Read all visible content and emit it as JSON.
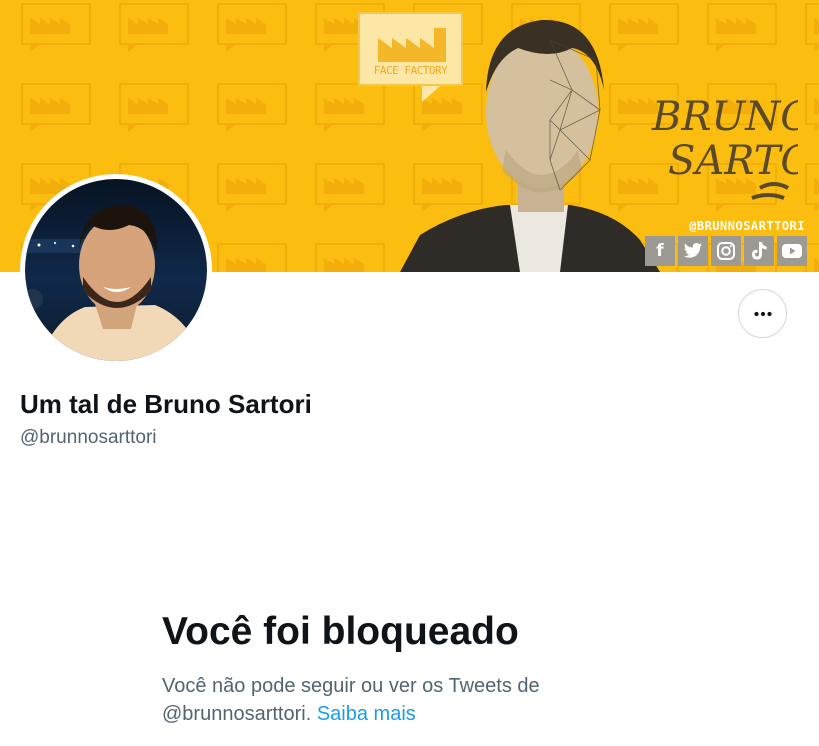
{
  "colors": {
    "banner_bg": "#fbbd0f",
    "primary_text": "#0f1419",
    "secondary_text": "#536471",
    "link": "#1d9bf0",
    "border": "#cfd9de"
  },
  "banner": {
    "brand_logo_text": "FACE FACTORY",
    "signature_text": "BRUNO SARTORI",
    "handle_text": "@BRUNNOSARTTORI",
    "social_icons": [
      "facebook-icon",
      "twitter-icon",
      "instagram-icon",
      "tiktok-icon",
      "youtube-icon"
    ]
  },
  "profile": {
    "display_name": "Um tal de Bruno Sartori",
    "handle": "@brunnosarttori",
    "more_icon": "more-horizontal-icon"
  },
  "blocked": {
    "title": "Você foi bloqueado",
    "message_line1": "Você não pode seguir ou ver os Tweets de",
    "message_line2": "@brunnosarttori.",
    "learn_more": "Saiba mais"
  }
}
